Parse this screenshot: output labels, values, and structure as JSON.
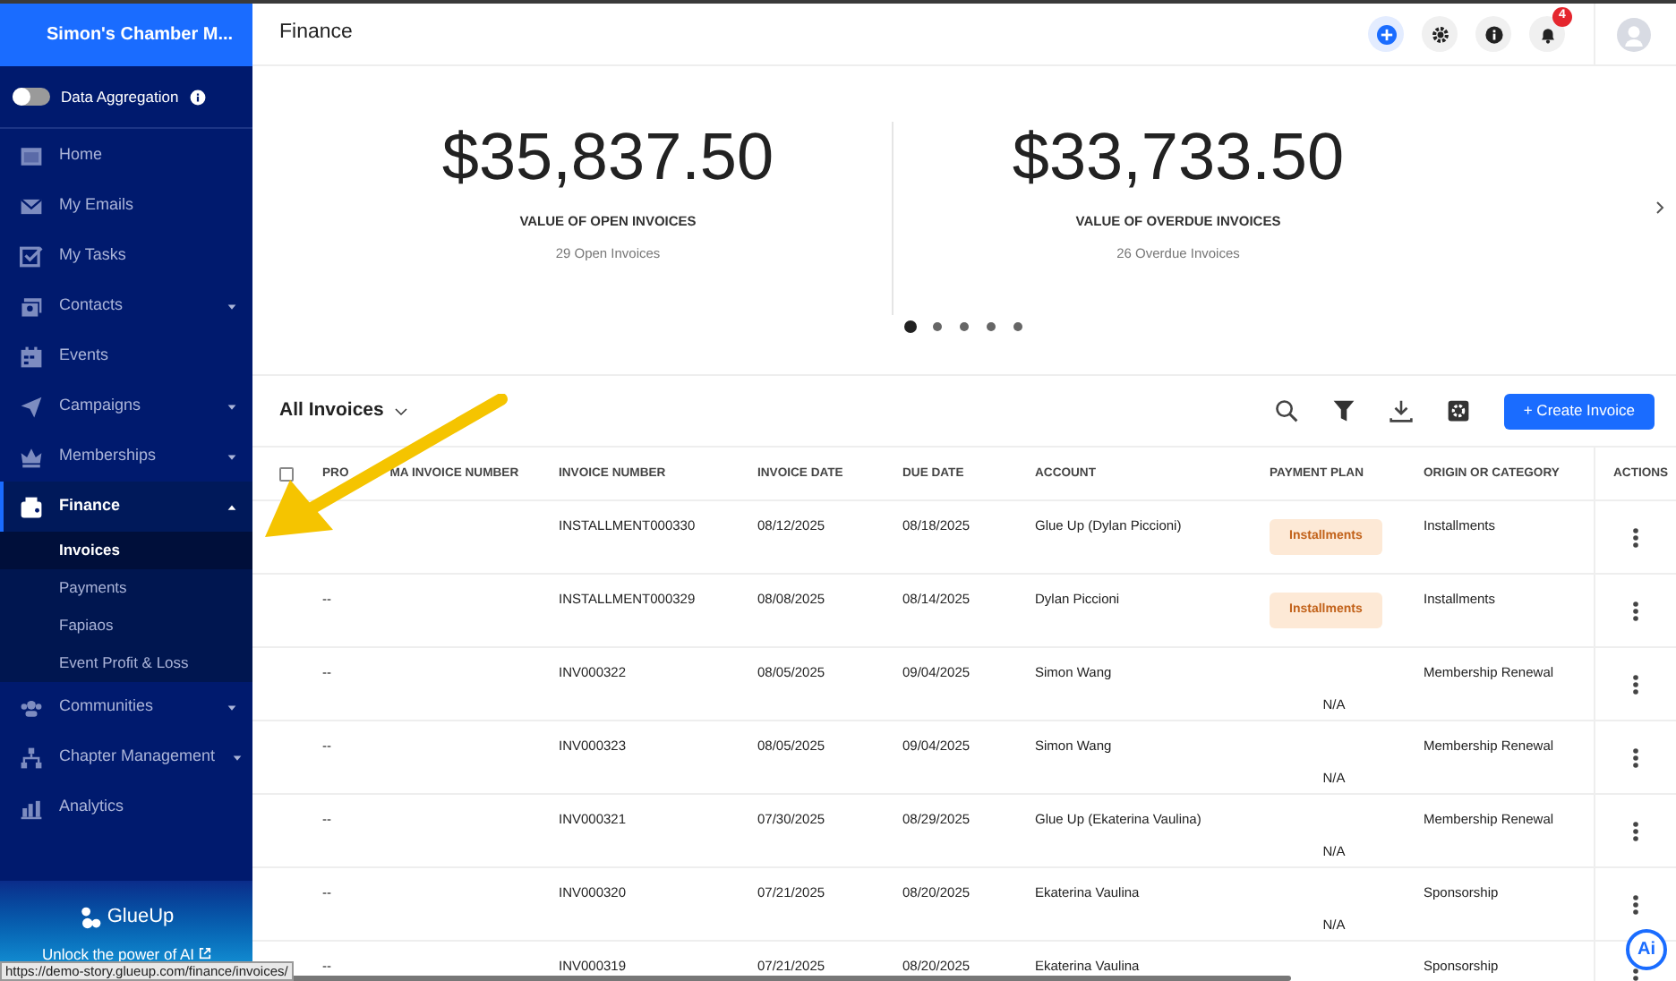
{
  "sidebar": {
    "org_name": "Simon's Chamber M...",
    "data_aggregation": {
      "label": "Data Aggregation",
      "on": false
    },
    "items": [
      {
        "label": "Home",
        "kind": "link",
        "selected": false
      },
      {
        "label": "My Emails",
        "kind": "link",
        "selected": false
      },
      {
        "label": "My Tasks",
        "kind": "link",
        "selected": false
      },
      {
        "label": "Contacts",
        "kind": "group",
        "expanded": false,
        "selected": false
      },
      {
        "label": "Events",
        "kind": "link",
        "selected": false
      },
      {
        "label": "Campaigns",
        "kind": "group",
        "expanded": false,
        "selected": false
      },
      {
        "label": "Memberships",
        "kind": "group",
        "expanded": false,
        "selected": false
      },
      {
        "label": "Finance",
        "kind": "group",
        "expanded": true,
        "selected": true,
        "children": [
          {
            "label": "Invoices",
            "selected": true
          },
          {
            "label": "Payments",
            "selected": false
          },
          {
            "label": "Fapiaos",
            "selected": false
          },
          {
            "label": "Event Profit & Loss",
            "selected": false
          }
        ]
      },
      {
        "label": "Communities",
        "kind": "group",
        "expanded": false,
        "selected": false
      },
      {
        "label": "Chapter Management",
        "kind": "group",
        "expanded": false,
        "selected": false
      },
      {
        "label": "Analytics",
        "kind": "link",
        "selected": false
      }
    ],
    "promo": {
      "brand": "GlueUp",
      "text": "Unlock the power of AI"
    }
  },
  "header": {
    "title": "Finance",
    "notifications": "4"
  },
  "stats": [
    {
      "amount": "$35,837.50",
      "label": "VALUE OF OPEN INVOICES",
      "sub": "29 Open Invoices"
    },
    {
      "amount": "$33,733.50",
      "label": "VALUE OF OVERDUE INVOICES",
      "sub": "26 Overdue Invoices"
    }
  ],
  "carousel_dots": [
    {
      "selected": true
    },
    {
      "selected": false
    },
    {
      "selected": false
    },
    {
      "selected": false
    },
    {
      "selected": false
    }
  ],
  "toolbar": {
    "view": "All Invoices",
    "create_button": "+ Create Invoice"
  },
  "table": {
    "select_all": {
      "checked": false
    },
    "first_column_parts": [
      "PRO",
      "MA INVOICE NUMBER"
    ],
    "columns": [
      "INVOICE NUMBER",
      "INVOICE DATE",
      "DUE DATE",
      "ACCOUNT",
      "PAYMENT PLAN",
      "ORIGIN OR CATEGORY",
      "ACTIONS"
    ],
    "rows": [
      {
        "proforma": "",
        "invoice_number": "INSTALLMENT000330",
        "invoice_date": "08/12/2025",
        "due_date": "08/18/2025",
        "account": "Glue Up (Dylan Piccioni)",
        "payment_plan": {
          "kind": "badge",
          "text": "Installments"
        },
        "origin": "Installments"
      },
      {
        "proforma": "--",
        "invoice_number": "INSTALLMENT000329",
        "invoice_date": "08/08/2025",
        "due_date": "08/14/2025",
        "account": "Dylan Piccioni",
        "payment_plan": {
          "kind": "badge",
          "text": "Installments"
        },
        "origin": "Installments"
      },
      {
        "proforma": "--",
        "invoice_number": "INV000322",
        "invoice_date": "08/05/2025",
        "due_date": "09/04/2025",
        "account": "Simon Wang",
        "payment_plan": {
          "kind": "text",
          "text": "N/A"
        },
        "origin": "Membership Renewal"
      },
      {
        "proforma": "--",
        "invoice_number": "INV000323",
        "invoice_date": "08/05/2025",
        "due_date": "09/04/2025",
        "account": "Simon Wang",
        "payment_plan": {
          "kind": "text",
          "text": "N/A"
        },
        "origin": "Membership Renewal"
      },
      {
        "proforma": "--",
        "invoice_number": "INV000321",
        "invoice_date": "07/30/2025",
        "due_date": "08/29/2025",
        "account": "Glue Up (Ekaterina Vaulina)",
        "payment_plan": {
          "kind": "text",
          "text": "N/A"
        },
        "origin": "Membership Renewal"
      },
      {
        "proforma": "--",
        "invoice_number": "INV000320",
        "invoice_date": "07/21/2025",
        "due_date": "08/20/2025",
        "account": "Ekaterina Vaulina",
        "payment_plan": {
          "kind": "text",
          "text": "N/A"
        },
        "origin": "Sponsorship"
      },
      {
        "proforma": "--",
        "invoice_number": "INV000319",
        "invoice_date": "07/21/2025",
        "due_date": "08/20/2025",
        "account": "Ekaterina Vaulina",
        "origin": "Sponsorship"
      }
    ]
  },
  "ai_button": "Ai",
  "status_url": "https://demo-story.glueup.com/finance/invoices/"
}
